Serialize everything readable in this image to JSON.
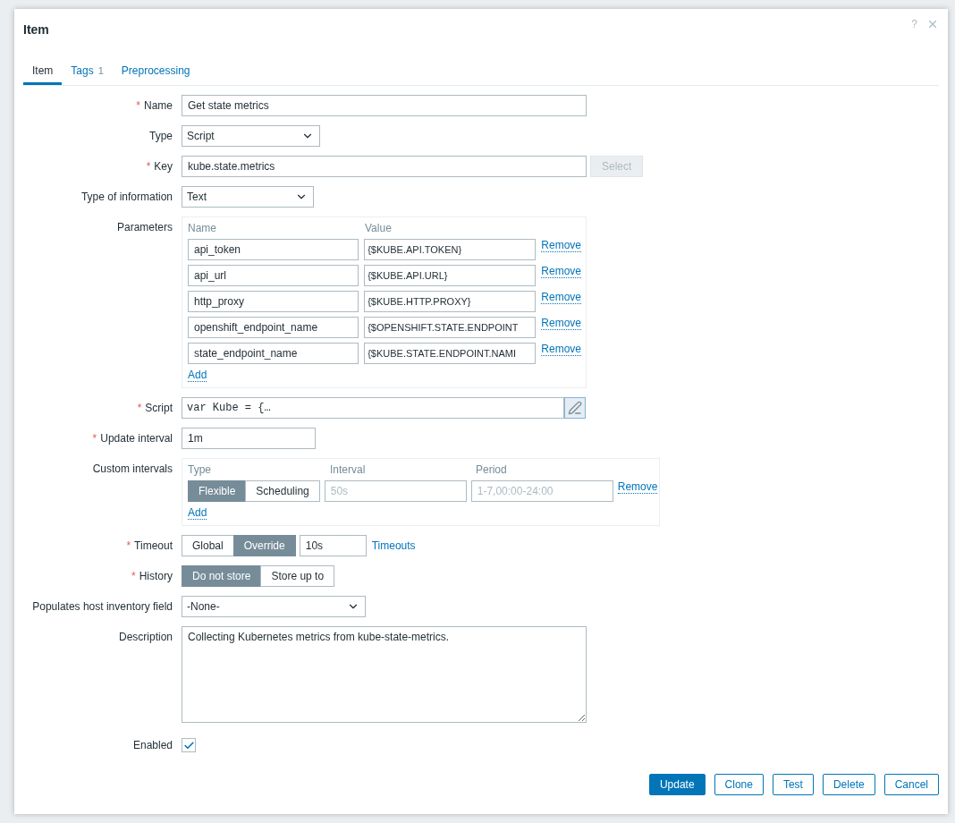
{
  "dialog": {
    "title": "Item",
    "help": "?",
    "required_mark": "*",
    "tabs": [
      {
        "label": "Item",
        "selected": true
      },
      {
        "label": "Tags",
        "count": "1",
        "selected": false
      },
      {
        "label": "Preprocessing",
        "selected": false
      }
    ],
    "fields": [
      {
        "kind": "text",
        "label": "Name",
        "required": true,
        "value": "Get state metrics"
      },
      {
        "kind": "select",
        "label": "Type",
        "required": false,
        "value": "Script"
      },
      {
        "kind": "text_button",
        "label": "Key",
        "required": true,
        "value": "kube.state.metrics",
        "button": {
          "label": "Select",
          "disabled": true
        }
      },
      {
        "kind": "select",
        "label": "Type of information",
        "required": false,
        "value": "Text"
      },
      {
        "kind": "params",
        "label": "Parameters",
        "required": false,
        "columns": [
          "Name",
          "Value"
        ],
        "rows": [
          {
            "name": "api_token",
            "value": "{$KUBE.API.TOKEN}",
            "action": "Remove"
          },
          {
            "name": "api_url",
            "value": "{$KUBE.API.URL}",
            "action": "Remove"
          },
          {
            "name": "http_proxy",
            "value": "{$KUBE.HTTP.PROXY}",
            "action": "Remove"
          },
          {
            "name": "openshift_endpoint_name",
            "value": "{$OPENSHIFT.STATE.ENDPOINT",
            "action": "Remove"
          },
          {
            "name": "state_endpoint_name",
            "value": "{$KUBE.STATE.ENDPOINT.NAMI",
            "action": "Remove"
          }
        ],
        "add": "Add"
      },
      {
        "kind": "script",
        "label": "Script",
        "required": true,
        "value": "var Kube = {…"
      },
      {
        "kind": "short_text",
        "label": "Update interval",
        "required": true,
        "value": "1m"
      },
      {
        "kind": "intervals",
        "label": "Custom intervals",
        "required": false,
        "columns": [
          "Type",
          "Interval",
          "Period"
        ],
        "rows": [
          {
            "options": [
              {
                "label": "Flexible",
                "selected": true
              },
              {
                "label": "Scheduling",
                "selected": false
              }
            ],
            "interval_placeholder": "50s",
            "period_placeholder": "1-7,00:00-24:00",
            "action": "Remove"
          }
        ],
        "add": "Add"
      },
      {
        "kind": "segmented_input",
        "label": "Timeout",
        "required": true,
        "options": [
          {
            "label": "Global",
            "selected": false
          },
          {
            "label": "Override",
            "selected": true
          }
        ],
        "value": "10s",
        "link": "Timeouts"
      },
      {
        "kind": "segmented",
        "label": "History",
        "required": true,
        "options": [
          {
            "label": "Do not store",
            "selected": true
          },
          {
            "label": "Store up to",
            "selected": false
          }
        ]
      },
      {
        "kind": "select",
        "label": "Populates host inventory field",
        "required": false,
        "value": "-None-"
      },
      {
        "kind": "textarea",
        "label": "Description",
        "required": false,
        "value": "Collecting Kubernetes metrics from kube-state-metrics."
      },
      {
        "kind": "checkbox",
        "label": "Enabled",
        "required": false,
        "checked": true
      }
    ],
    "buttons": [
      {
        "label": "Update",
        "primary": true
      },
      {
        "label": "Clone",
        "primary": false
      },
      {
        "label": "Test",
        "primary": false
      },
      {
        "label": "Delete",
        "primary": false
      },
      {
        "label": "Cancel",
        "primary": false
      }
    ]
  }
}
